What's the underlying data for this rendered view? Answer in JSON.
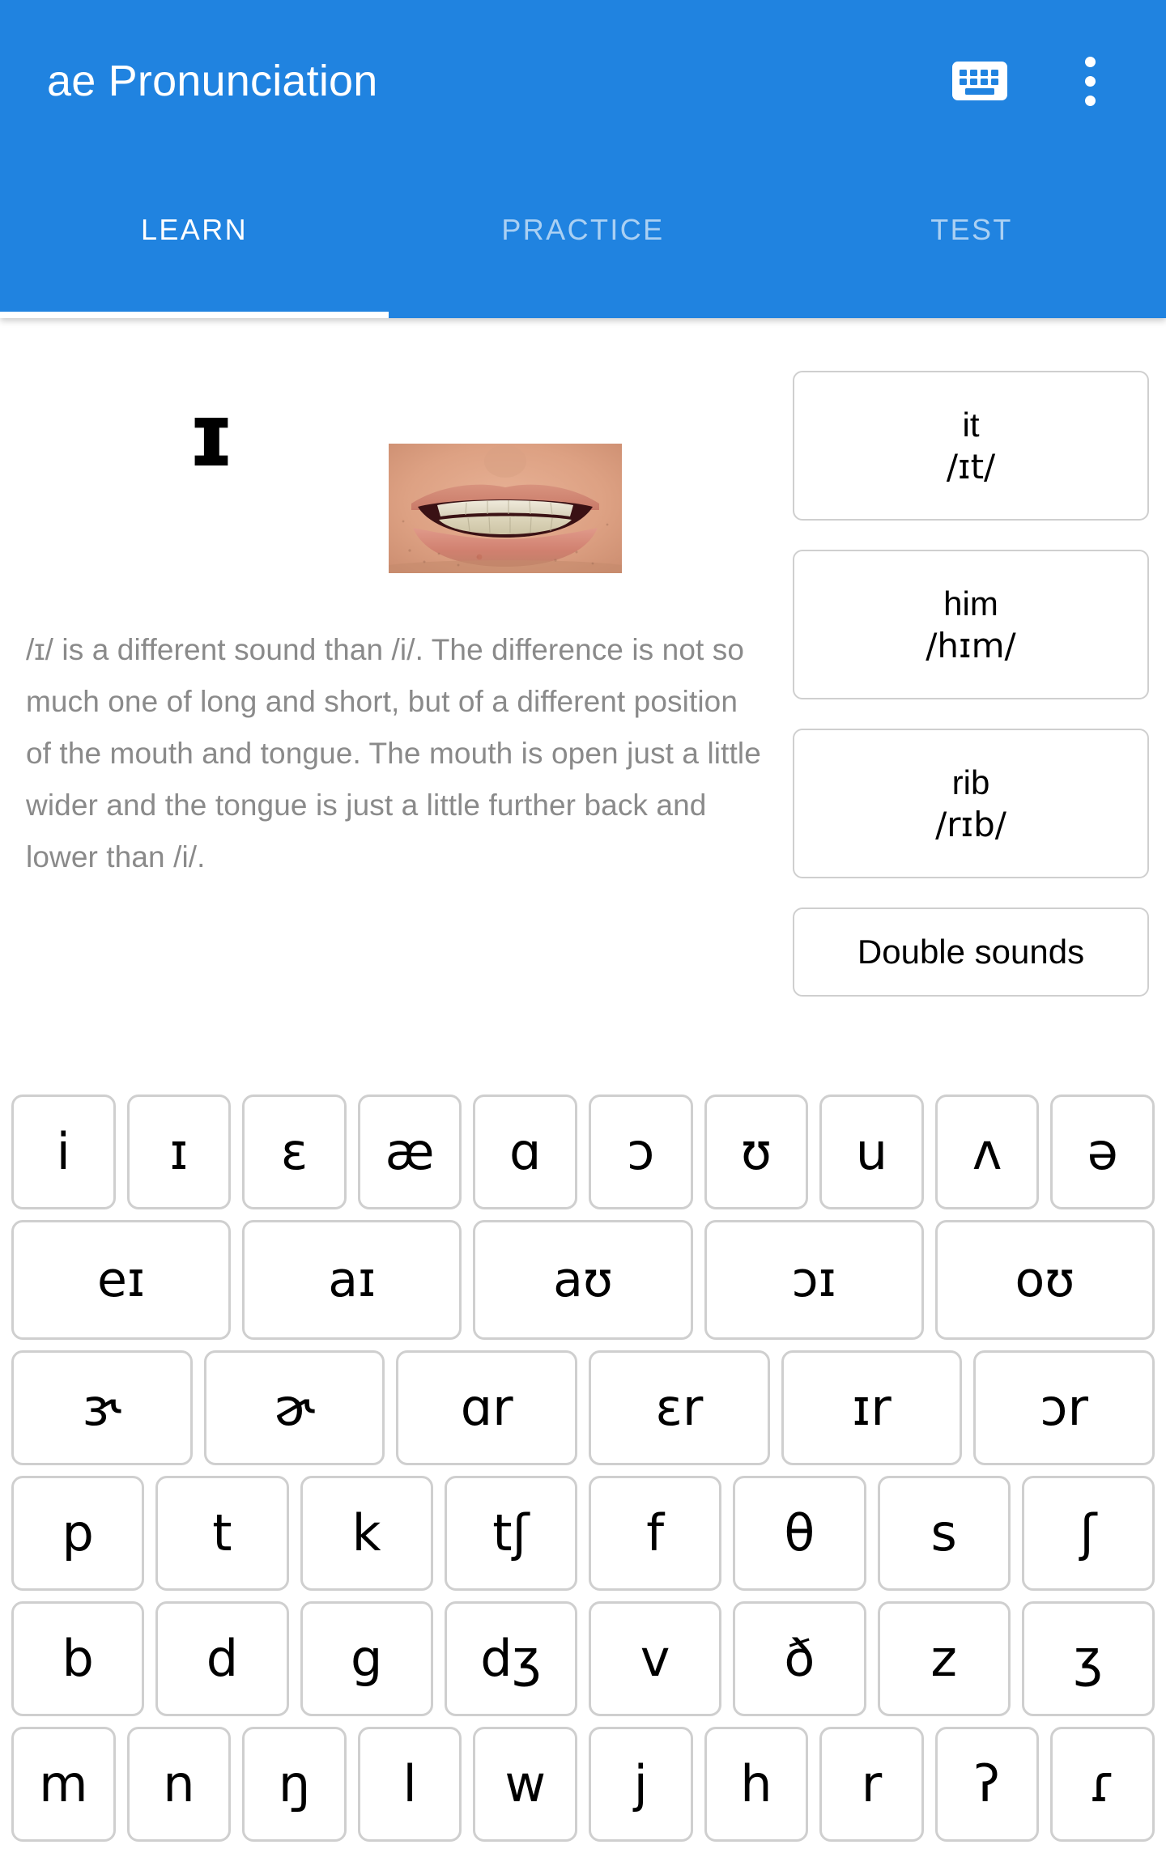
{
  "app": {
    "title": "ae Pronunciation",
    "accent_color": "#2083e0",
    "key_border_color": "#cfcfcf",
    "body_text_color": "#8a8a8a"
  },
  "appbar": {
    "keyboard_icon": "keyboard-icon",
    "overflow_icon": "more-vertical-icon"
  },
  "tabs": [
    {
      "label": "LEARN",
      "active": true
    },
    {
      "label": "PRACTICE",
      "active": false
    },
    {
      "label": "TEST",
      "active": false
    }
  ],
  "lesson": {
    "symbol": "ɪ",
    "mouth_image_alt": "mouth-articulation-photo",
    "description": "/ɪ/ is a different sound than /i/. The difference is not so much one of long and short, but of a different position of the mouth and tongue. The mouth is open just a little wider and the tongue is just a little further back and lower than /i/."
  },
  "word_cards": [
    {
      "word": "it",
      "ipa": "/ɪt/",
      "type": "word"
    },
    {
      "word": "him",
      "ipa": "/hɪm/",
      "type": "word"
    },
    {
      "word": "rib",
      "ipa": "/rɪb/",
      "type": "word"
    },
    {
      "label": "Double sounds",
      "type": "action"
    }
  ],
  "keyboard": {
    "rows": [
      {
        "name": "monophthongs",
        "keys": [
          "i",
          "ɪ",
          "ɛ",
          "æ",
          "ɑ",
          "ɔ",
          "ʊ",
          "u",
          "ʌ",
          "ə"
        ]
      },
      {
        "name": "diphthongs",
        "keys": [
          "eɪ",
          "aɪ",
          "aʊ",
          "ɔɪ",
          "oʊ"
        ]
      },
      {
        "name": "r-colored",
        "keys": [
          "ɝ",
          "ɚ",
          "ɑr",
          "ɛr",
          "ɪr",
          "ɔr"
        ]
      },
      {
        "name": "voiceless",
        "keys": [
          "p",
          "t",
          "k",
          "tʃ",
          "f",
          "θ",
          "s",
          "ʃ"
        ]
      },
      {
        "name": "voiced",
        "keys": [
          "b",
          "d",
          "g",
          "dʒ",
          "v",
          "ð",
          "z",
          "ʒ"
        ]
      },
      {
        "name": "sonorants",
        "keys": [
          "m",
          "n",
          "ŋ",
          "l",
          "w",
          "j",
          "h",
          "r",
          "ʔ",
          "ɾ"
        ]
      }
    ]
  }
}
